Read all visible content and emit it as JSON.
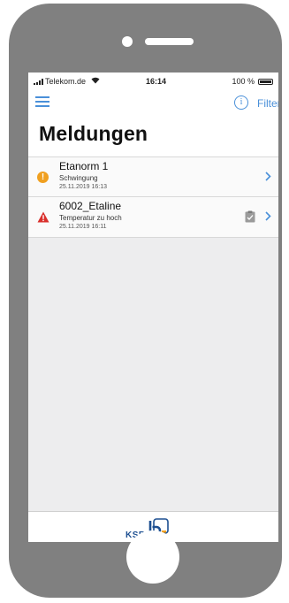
{
  "status_bar": {
    "carrier": "Telekom.de",
    "time": "16:14",
    "battery_percent": "100 %"
  },
  "header": {
    "filter_label": "Filter",
    "info_glyph": "i",
    "title": "Meldungen"
  },
  "messages": [
    {
      "title": "Etanorm 1",
      "subtitle": "Schwingung",
      "date": "25.11.2019 16:13",
      "severity": "warning",
      "icon": "warning-circle-icon",
      "has_note": false
    },
    {
      "title": "6002_Etaline",
      "subtitle": "Temperatur zu hoch",
      "date": "25.11.2019 16:11",
      "severity": "alarm",
      "icon": "alert-triangle-icon",
      "has_note": true
    }
  ],
  "footer": {
    "logo_text": "KSB",
    "logo_icon": "ksb-logo-icon"
  },
  "colors": {
    "accent": "#4a90d9",
    "warning": "#f0a020",
    "alarm": "#d9302c",
    "logo": "#1d4f91",
    "device_frame": "#808080"
  }
}
